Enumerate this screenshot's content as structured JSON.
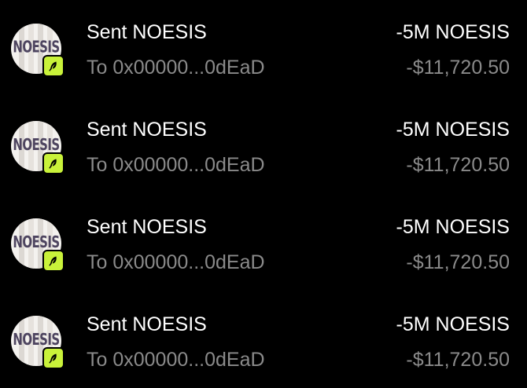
{
  "colors": {
    "background": "#000000",
    "primary_text": "#ffffff",
    "secondary_text": "#8a8a8a",
    "chain_badge": "#c9f23a"
  },
  "transactions": [
    {
      "title": "Sent NOESIS",
      "subtitle": "To 0x00000...0dEaD",
      "amount": "-5M NOESIS",
      "fiat": "-$11,720.50",
      "token_logo_text": "NOESIS",
      "token_icon": "noesis-token-icon",
      "chain_icon": "lime-chain-icon"
    },
    {
      "title": "Sent NOESIS",
      "subtitle": "To 0x00000...0dEaD",
      "amount": "-5M NOESIS",
      "fiat": "-$11,720.50",
      "token_logo_text": "NOESIS",
      "token_icon": "noesis-token-icon",
      "chain_icon": "lime-chain-icon"
    },
    {
      "title": "Sent NOESIS",
      "subtitle": "To 0x00000...0dEaD",
      "amount": "-5M NOESIS",
      "fiat": "-$11,720.50",
      "token_logo_text": "NOESIS",
      "token_icon": "noesis-token-icon",
      "chain_icon": "lime-chain-icon"
    },
    {
      "title": "Sent NOESIS",
      "subtitle": "To 0x00000...0dEaD",
      "amount": "-5M NOESIS",
      "fiat": "-$11,720.50",
      "token_logo_text": "NOESIS",
      "token_icon": "noesis-token-icon",
      "chain_icon": "lime-chain-icon"
    }
  ]
}
